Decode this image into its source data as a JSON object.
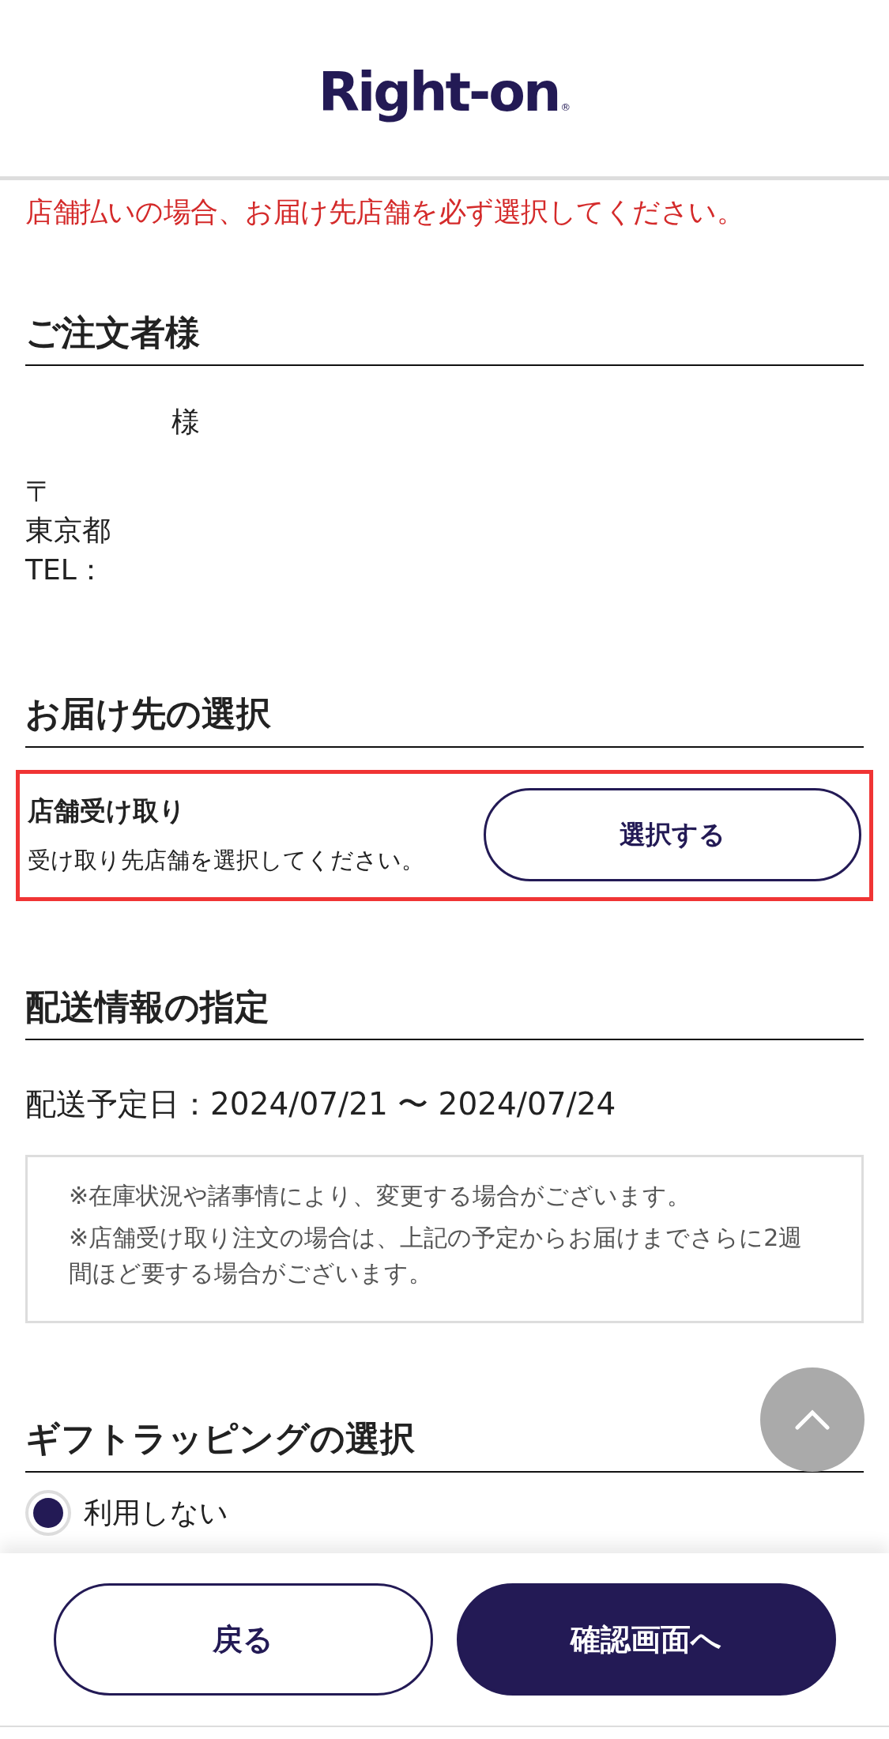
{
  "header": {
    "logo": "Right-on",
    "logo_mark": "®"
  },
  "alert": "店舗払いの場合、お届け先店舗を必ず選択してください。",
  "orderer": {
    "title": "ご注文者様",
    "name_suffix": "様",
    "postal_mark": "〒",
    "address": "東京都",
    "tel_label": "TEL："
  },
  "destination": {
    "title": "お届け先の選択",
    "method": "店舗受け取り",
    "hint": "受け取り先店舗を選択してください。",
    "button": "選択する",
    "highlighted": true
  },
  "shipping": {
    "title": "配送情報の指定",
    "date": "配送予定日：2024/07/21 〜 2024/07/24",
    "notes": [
      "※在庫状況や諸事情により、変更する場合がございます。",
      "※店舗受け取り注文の場合は、上記の予定からお届けまでさらに2週間ほど要する場合がございます。"
    ]
  },
  "gift": {
    "title": "ギフトラッピングの選択",
    "options": [
      {
        "label": "利用しない",
        "selected": true
      }
    ]
  },
  "footer": {
    "buttons": [
      {
        "label": "戻る",
        "kind": "secondary"
      },
      {
        "label": "確認画面へ",
        "kind": "primary"
      }
    ]
  }
}
